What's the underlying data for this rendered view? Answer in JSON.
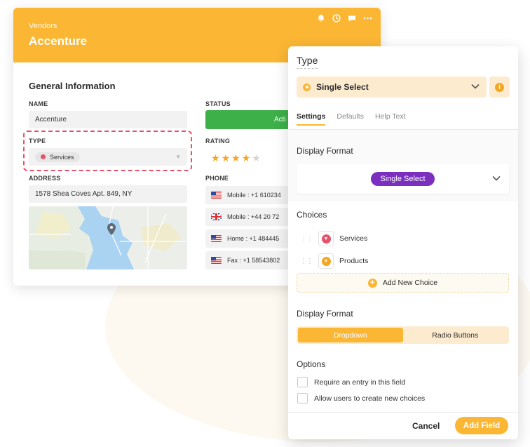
{
  "vendor_card": {
    "eyebrow": "Vendors",
    "title": "Accenture",
    "section_title": "General Information",
    "name_label": "NAME",
    "name_value": "Accenture",
    "type_label": "TYPE",
    "type_value": "Services",
    "address_label": "ADDRESS",
    "address_value": "1578 Shea Coves Apt. 849, NY",
    "status_label": "STATUS",
    "status_value": "Acti",
    "rating_label": "RATING",
    "rating": 4,
    "rating_max": 5,
    "phone_label": "PHONE",
    "phones": [
      {
        "flag": "us",
        "text": "Mobile : +1 610234"
      },
      {
        "flag": "uk",
        "text": "Mobile : +44 20 72"
      },
      {
        "flag": "us",
        "text": "Home : +1 484445"
      },
      {
        "flag": "us",
        "text": "Fax : +1 58543802"
      }
    ],
    "header_icons": [
      "bell-icon",
      "clock-icon",
      "chat-icon",
      "more-icon"
    ],
    "accent_color": "#fbb634"
  },
  "field_panel": {
    "title": "Type",
    "field_type": "Single Select",
    "tabs": [
      {
        "label": "Settings",
        "active": true
      },
      {
        "label": "Defaults",
        "active": false
      },
      {
        "label": "Help Text",
        "active": false
      }
    ],
    "display_format_label": "Display Format",
    "display_format_pill": "Single Select",
    "choices_label": "Choices",
    "choices": [
      {
        "label": "Services",
        "color": "#e5536b"
      },
      {
        "label": "Products",
        "color": "#f5a623"
      }
    ],
    "add_choice_label": "Add New Choice",
    "display_format2_label": "Display Format",
    "format_options": [
      {
        "label": "Dropdown",
        "selected": true
      },
      {
        "label": "Radio Buttons",
        "selected": false
      }
    ],
    "options_label": "Options",
    "options": [
      {
        "label": "Require an entry in this field",
        "checked": false
      },
      {
        "label": "Allow users to create new choices",
        "checked": false
      }
    ],
    "cancel_label": "Cancel",
    "submit_label": "Add Field",
    "pill_color": "#7b2fbe"
  }
}
